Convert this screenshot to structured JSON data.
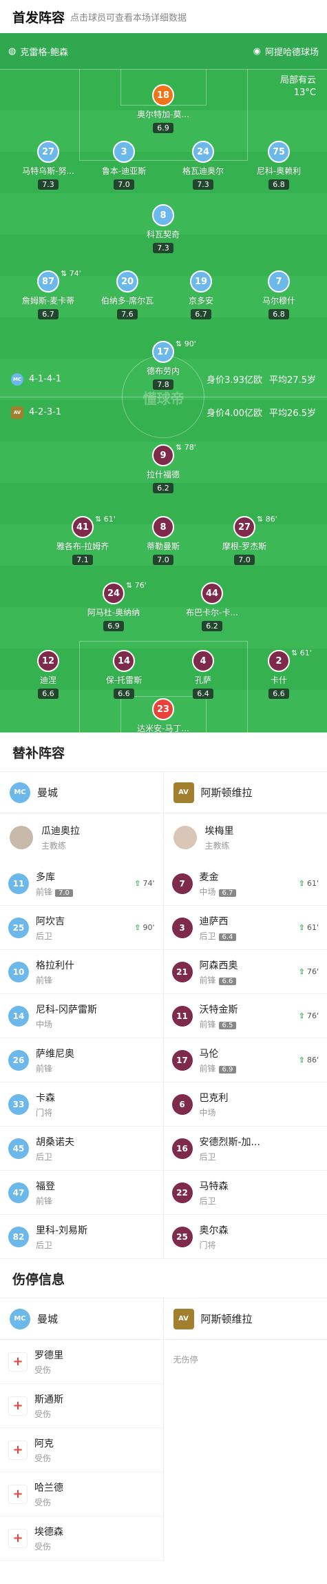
{
  "lineup": {
    "title": "首发阵容",
    "subtitle": "点击球员可查看本场详细数据"
  },
  "venue": {
    "referee": "克雷格-鲍森",
    "stadium": "阿提哈德球场"
  },
  "weather": {
    "condition": "局部有云",
    "temp": "13°C"
  },
  "home": {
    "formation": "4-1-4-1",
    "value": "身价3.93亿欧",
    "age": "平均27.5岁",
    "players": [
      {
        "num": "18",
        "name": "奥尔特加-莫...",
        "rating": "6.9"
      },
      {
        "num": "27",
        "name": "马特乌斯-努...",
        "rating": "7.3"
      },
      {
        "num": "3",
        "name": "鲁本-迪亚斯",
        "rating": "7.0"
      },
      {
        "num": "24",
        "name": "格瓦迪奥尔",
        "rating": "7.3"
      },
      {
        "num": "75",
        "name": "尼科-奥赖利",
        "rating": "6.8"
      },
      {
        "num": "8",
        "name": "科瓦契奇",
        "rating": "7.3"
      },
      {
        "num": "87",
        "name": "詹姆斯-麦卡蒂",
        "rating": "6.7",
        "sub": "74'"
      },
      {
        "num": "20",
        "name": "伯纳多-席尔瓦",
        "rating": "7.6"
      },
      {
        "num": "19",
        "name": "京多安",
        "rating": "6.7"
      },
      {
        "num": "7",
        "name": "马尔穆什",
        "rating": "6.8"
      },
      {
        "num": "17",
        "name": "德布劳内",
        "rating": "7.8",
        "sub": "90'"
      }
    ]
  },
  "away": {
    "formation": "4-2-3-1",
    "value": "身价4.00亿欧",
    "age": "平均26.5岁",
    "players": [
      {
        "num": "9",
        "name": "拉什福德",
        "rating": "6.2",
        "sub": "78'"
      },
      {
        "num": "41",
        "name": "雅各布-拉姆齐",
        "rating": "7.1",
        "sub": "61'"
      },
      {
        "num": "8",
        "name": "蒂勒曼斯",
        "rating": "7.0"
      },
      {
        "num": "27",
        "name": "摩根-罗杰斯",
        "rating": "7.0",
        "sub": "86'"
      },
      {
        "num": "24",
        "name": "阿马杜-奥纳纳",
        "rating": "6.9",
        "sub": "76'"
      },
      {
        "num": "44",
        "name": "布巴卡尔-卡...",
        "rating": "6.2"
      },
      {
        "num": "12",
        "name": "迪涅",
        "rating": "6.6"
      },
      {
        "num": "14",
        "name": "保-托雷斯",
        "rating": "6.6"
      },
      {
        "num": "4",
        "name": "孔萨",
        "rating": "6.4"
      },
      {
        "num": "2",
        "name": "卡什",
        "rating": "6.6",
        "sub": "61'"
      },
      {
        "num": "23",
        "name": "达米安-马丁...",
        "rating": "7.3"
      }
    ]
  },
  "watermark": "懂球帝",
  "subs": {
    "title": "替补阵容",
    "home_team": "曼城",
    "away_team": "阿斯顿维拉",
    "coach_label": "主教练",
    "home_coach": "瓜迪奥拉",
    "away_coach": "埃梅里",
    "home": [
      {
        "num": "11",
        "name": "多库",
        "pos": "前锋",
        "rating": "7.0",
        "time": "74'"
      },
      {
        "num": "25",
        "name": "阿坎吉",
        "pos": "后卫",
        "time": "90'"
      },
      {
        "num": "10",
        "name": "格拉利什",
        "pos": "前锋"
      },
      {
        "num": "14",
        "name": "尼科-冈萨雷斯",
        "pos": "中场"
      },
      {
        "num": "26",
        "name": "萨维尼奥",
        "pos": "前锋"
      },
      {
        "num": "33",
        "name": "卡森",
        "pos": "门将"
      },
      {
        "num": "45",
        "name": "胡桑诺夫",
        "pos": "后卫"
      },
      {
        "num": "47",
        "name": "福登",
        "pos": "前锋"
      },
      {
        "num": "82",
        "name": "里科-刘易斯",
        "pos": "后卫"
      }
    ],
    "away": [
      {
        "num": "7",
        "name": "麦金",
        "pos": "中场",
        "rating": "6.7",
        "time": "61'"
      },
      {
        "num": "3",
        "name": "迪萨西",
        "pos": "后卫",
        "rating": "6.4",
        "time": "61'"
      },
      {
        "num": "21",
        "name": "阿森西奥",
        "pos": "前锋",
        "rating": "6.6",
        "time": "76'"
      },
      {
        "num": "11",
        "name": "沃特金斯",
        "pos": "前锋",
        "rating": "6.5",
        "time": "76'"
      },
      {
        "num": "17",
        "name": "马伦",
        "pos": "前锋",
        "rating": "6.9",
        "time": "86'"
      },
      {
        "num": "6",
        "name": "巴克利",
        "pos": "中场"
      },
      {
        "num": "16",
        "name": "安德烈斯-加...",
        "pos": "后卫"
      },
      {
        "num": "22",
        "name": "马特森",
        "pos": "后卫"
      },
      {
        "num": "25",
        "name": "奥尔森",
        "pos": "门将"
      }
    ]
  },
  "injuries": {
    "title": "伤停信息",
    "home_team": "曼城",
    "away_team": "阿斯顿维拉",
    "home": [
      {
        "name": "罗德里",
        "status": "受伤"
      },
      {
        "name": "斯通斯",
        "status": "受伤"
      },
      {
        "name": "阿克",
        "status": "受伤"
      },
      {
        "name": "哈兰德",
        "status": "受伤"
      },
      {
        "name": "埃德森",
        "status": "受伤"
      }
    ],
    "away_none": "无伤停"
  },
  "colors": {
    "pitch": "#36b150",
    "home": "#6cb8ea",
    "away": "#7e2a4a"
  }
}
